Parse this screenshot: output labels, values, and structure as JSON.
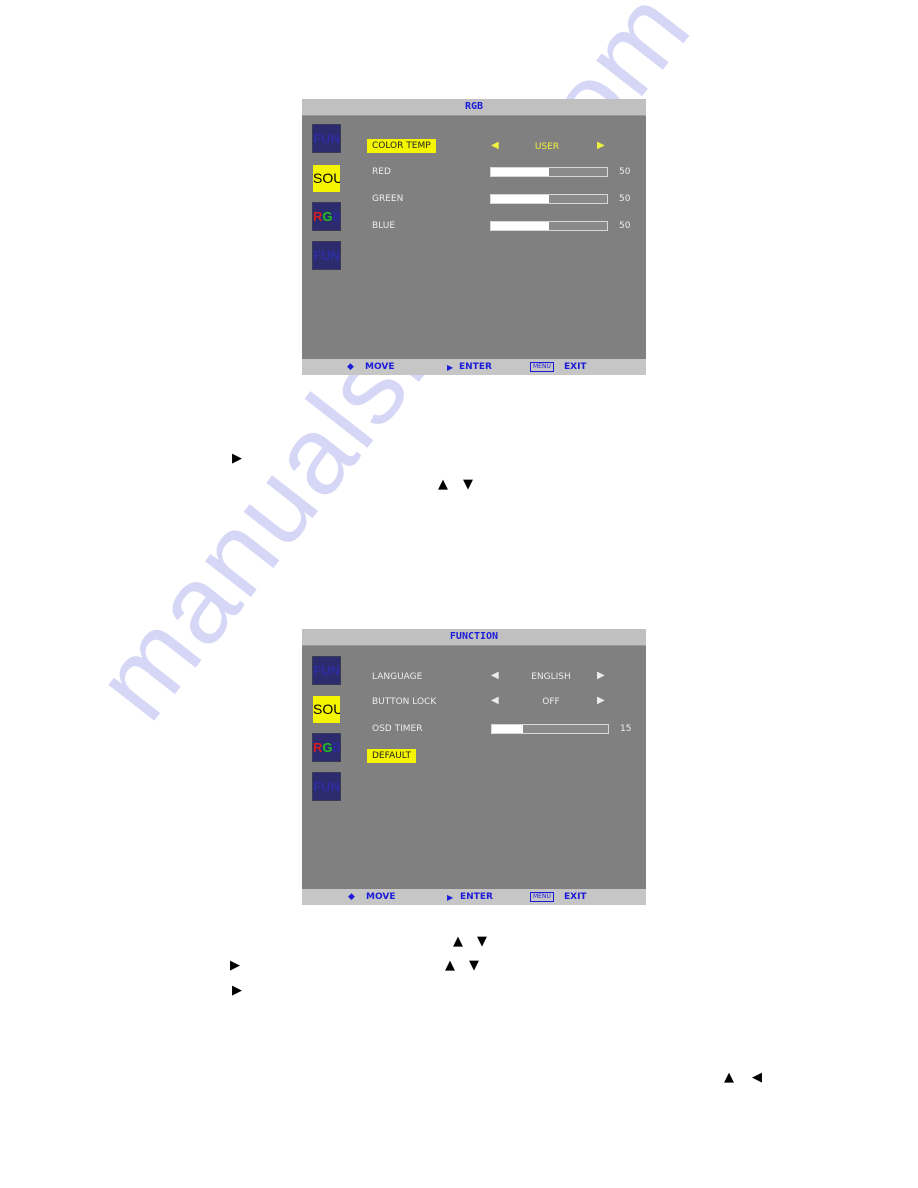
{
  "watermark": "manualshive.com",
  "rgb_menu": {
    "title": "RGB",
    "sidebar_icons": [
      {
        "label": "FUN",
        "selected": false
      },
      {
        "label": "SOU",
        "selected": true
      },
      {
        "label_r": "R",
        "label_g": "G",
        "label_b": "B",
        "selected": false
      },
      {
        "label": "FUN",
        "selected": false
      }
    ],
    "color_temp": {
      "label": "COLOR TEMP",
      "value": "USER",
      "left_arrow": "◀",
      "right_arrow": "▶"
    },
    "sliders": [
      {
        "label": "RED",
        "value": "50",
        "fraction": 0.5
      },
      {
        "label": "GREEN",
        "value": "50",
        "fraction": 0.5
      },
      {
        "label": "BLUE",
        "value": "50",
        "fraction": 0.5
      }
    ],
    "footer": {
      "move_icon": "◆",
      "move": "MOVE",
      "enter_icon": "▶",
      "enter": "ENTER",
      "menu_badge": "MENU",
      "exit": "EXIT"
    }
  },
  "function_menu": {
    "title": "FUNCTION",
    "sidebar_icons": [
      {
        "label": "FUN",
        "selected": false
      },
      {
        "label": "SOU",
        "selected": true
      },
      {
        "label_r": "R",
        "label_g": "G",
        "label_b": "B",
        "selected": false
      },
      {
        "label": "FUN",
        "selected": false
      }
    ],
    "language": {
      "label": "LANGUAGE",
      "value": "ENGLISH",
      "left_arrow": "◀",
      "right_arrow": "▶"
    },
    "button_lock": {
      "label": "BUTTON LOCK",
      "value": "OFF",
      "left_arrow": "◀",
      "right_arrow": "▶"
    },
    "osd_timer": {
      "label": "OSD TIMER",
      "value": "15",
      "fraction": 0.27
    },
    "default": {
      "label": "DEFAULT"
    },
    "footer": {
      "move_icon": "◆",
      "move": "MOVE",
      "enter_icon": "▶",
      "enter": "ENTER",
      "menu_badge": "MENU",
      "exit": "EXIT"
    }
  },
  "doc_glyphs": {
    "right": "▶",
    "up": "▲",
    "down": "▼",
    "left": "◀"
  }
}
